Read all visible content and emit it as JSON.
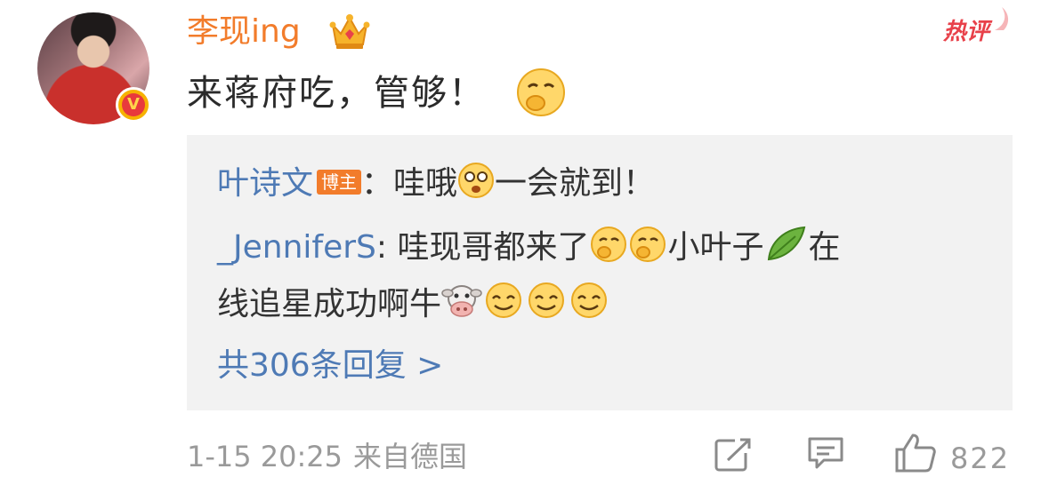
{
  "post": {
    "username": "李现ing",
    "hot_label": "热评",
    "comment_text": "来蒋府吃，管够！"
  },
  "replies": [
    {
      "name": "叶诗文",
      "tag": "博主",
      "separator": "：",
      "text_a": "哇哦",
      "text_b": "一会就到！"
    },
    {
      "name": "_JenniferS",
      "separator": ": ",
      "text_a": "哇现哥都来了",
      "text_b": "小叶子",
      "text_c": "在",
      "text_d": "线追星成功啊牛"
    }
  ],
  "more_replies": "共306条回复 >",
  "footer": {
    "date": "1-15 20:25",
    "source": "来自德国",
    "like_count": "822"
  },
  "icons": {
    "avatar": "user-avatar",
    "verified": "verified-v-badge",
    "crown": "crown-icon",
    "share": "share-icon",
    "comment": "comment-icon",
    "like": "thumbs-up-icon"
  },
  "colors": {
    "username": "#f27c2b",
    "link": "#4e7ab5",
    "hot": "#e8414a",
    "meta": "#9a9a9a",
    "reply_bg": "#f2f2f2"
  }
}
